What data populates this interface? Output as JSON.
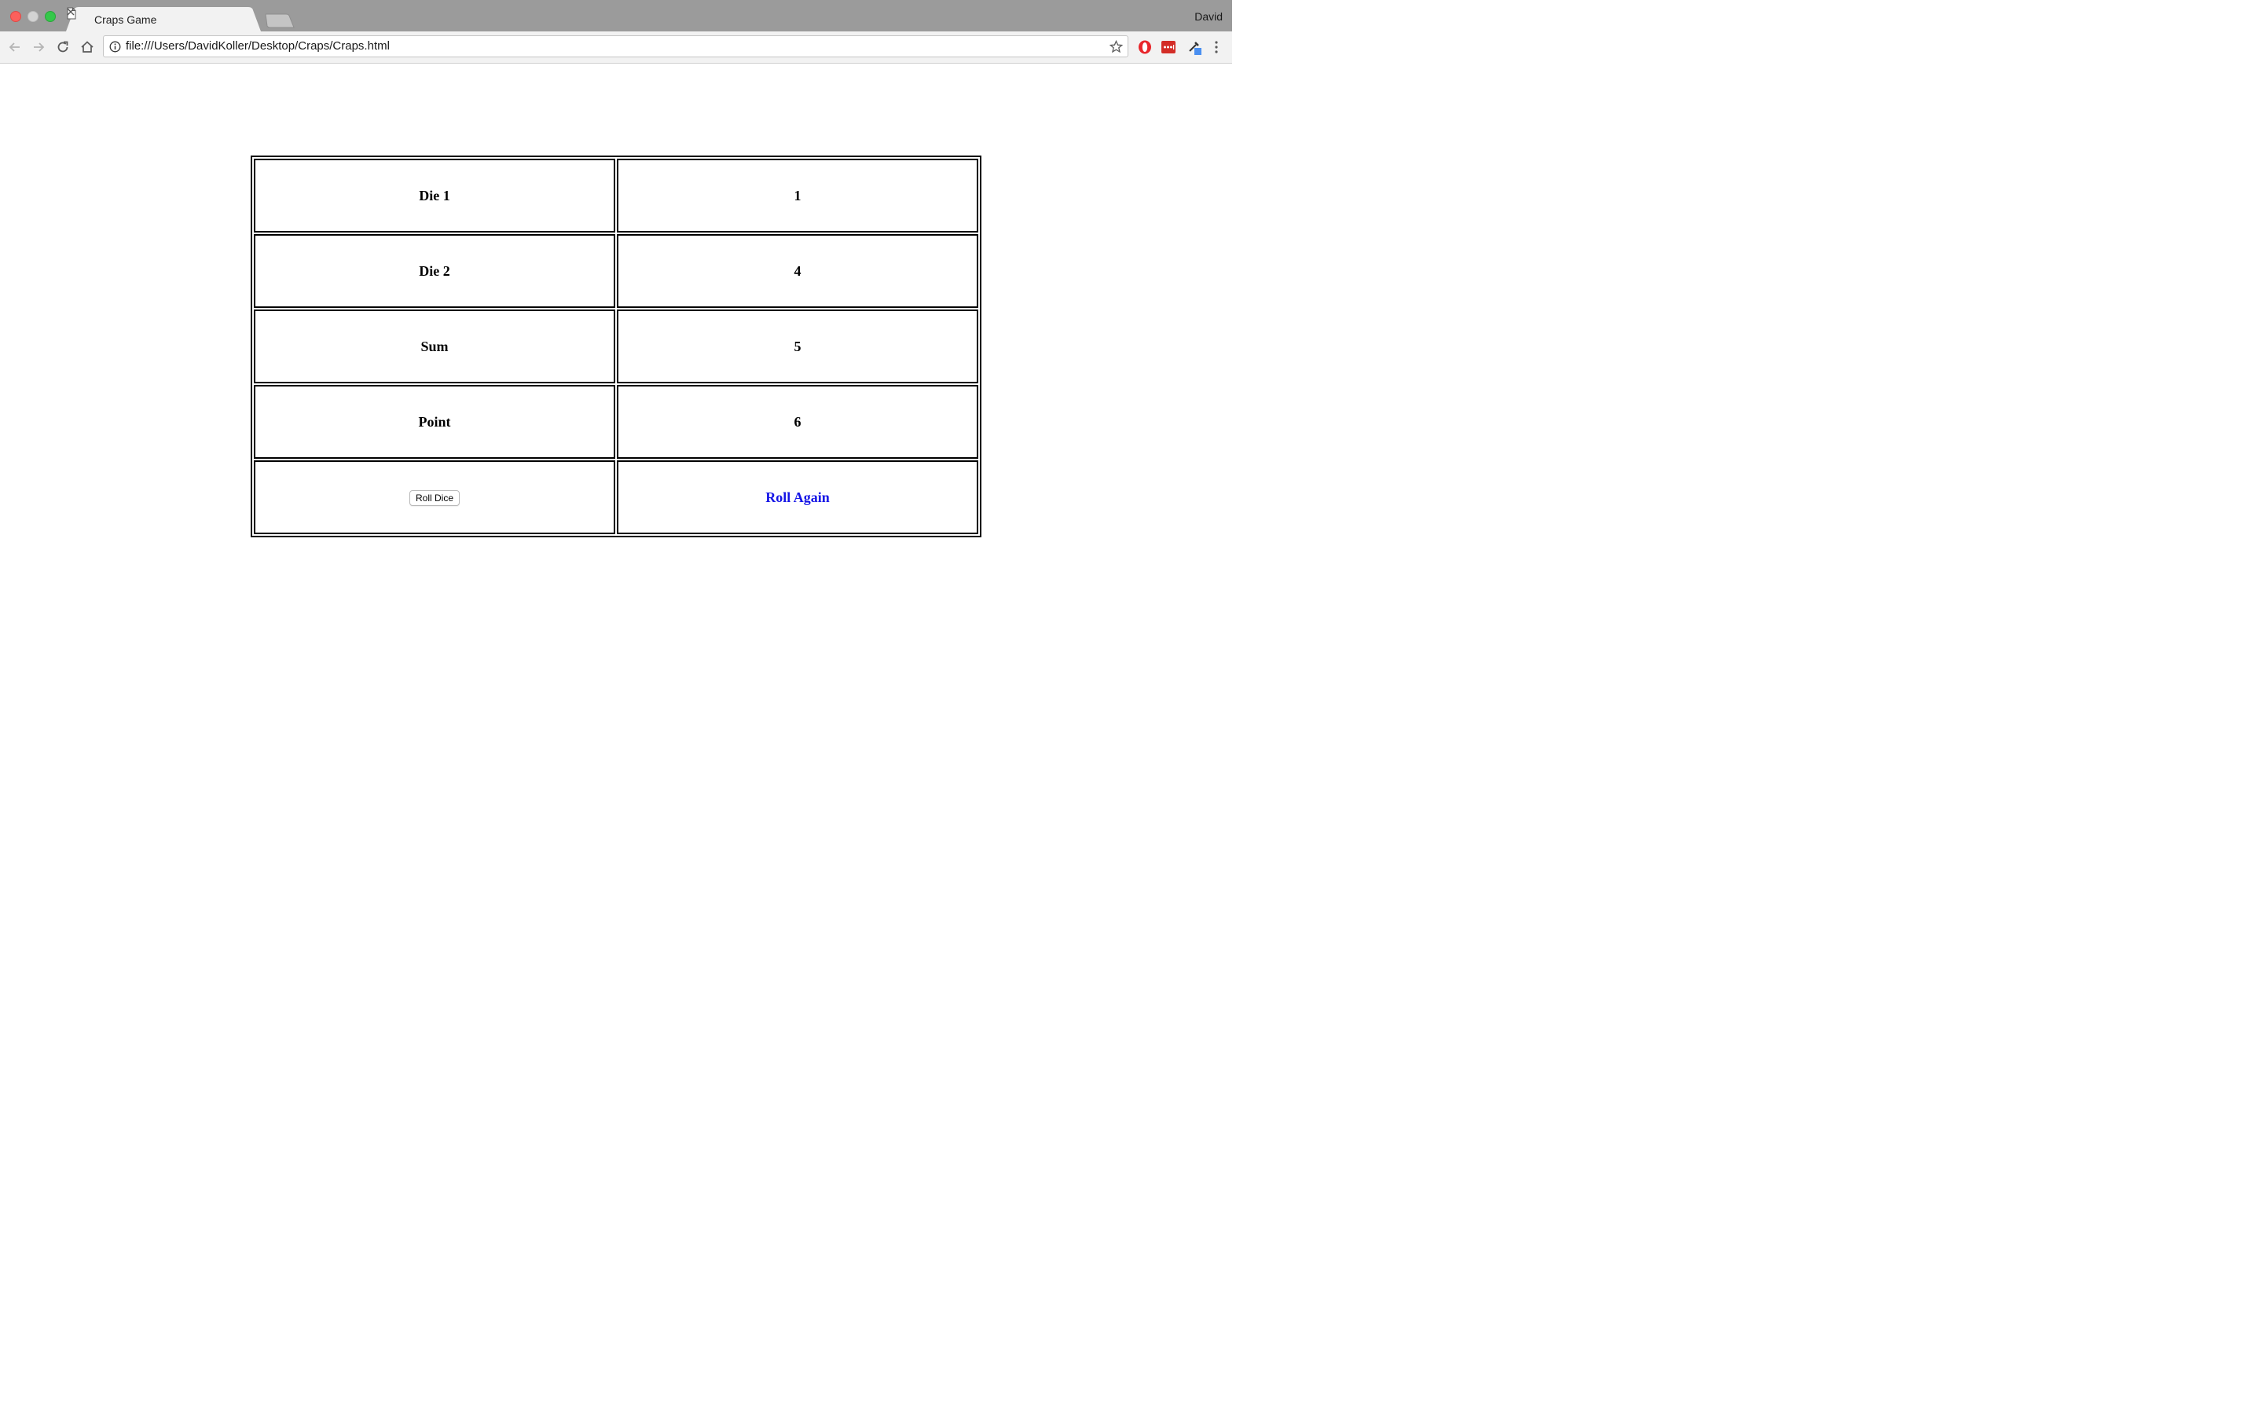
{
  "window": {
    "profile_name": "David"
  },
  "tab": {
    "title": "Craps Game",
    "close_icon": "close-icon",
    "page_icon": "document-icon"
  },
  "toolbar": {
    "url": "file:///Users/DavidKoller/Desktop/Craps/Craps.html",
    "back_icon": "arrow-left-icon",
    "forward_icon": "arrow-right-icon",
    "reload_icon": "reload-icon",
    "home_icon": "home-icon",
    "info_icon": "info-icon",
    "bookmark_icon": "star-icon",
    "extensions": [
      "opera-icon",
      "lastpass-icon",
      "eyedropper-icon",
      "menu-dots-icon"
    ]
  },
  "game": {
    "rows": [
      {
        "label": "Die 1",
        "value": "1"
      },
      {
        "label": "Die 2",
        "value": "4"
      },
      {
        "label": "Sum",
        "value": "5"
      },
      {
        "label": "Point",
        "value": "6"
      }
    ],
    "roll_button_label": "Roll Dice",
    "status_text": "Roll Again",
    "status_color": "#1414e6"
  }
}
